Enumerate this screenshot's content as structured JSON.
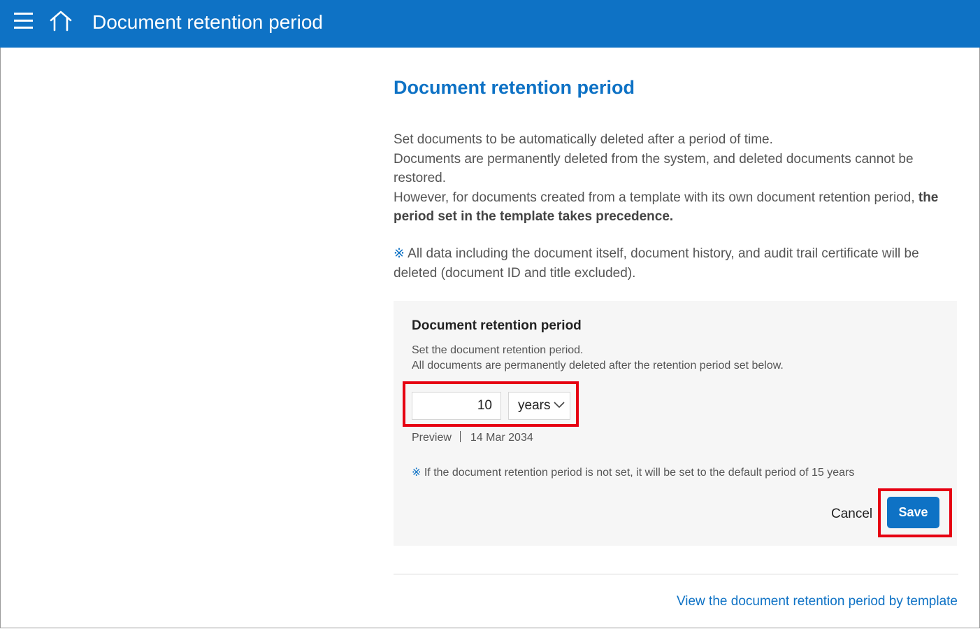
{
  "header": {
    "title": "Document retention period"
  },
  "main": {
    "title": "Document retention period",
    "description": {
      "line1": "Set documents to be automatically deleted after a period of time.",
      "line2": "Documents are permanently deleted from the system, and deleted documents cannot be restored.",
      "line3_plain": "However, for documents created from a template with its own document retention period, ",
      "line3_bold": "the period set in the template takes precedence."
    },
    "note": {
      "mark": "※",
      "text": "All data including the document itself, document history, and audit trail certificate will be deleted (document ID and title excluded)."
    }
  },
  "panel": {
    "title": "Document retention period",
    "desc1": "Set the document retention period.",
    "desc2": "All documents are permanently deleted after the retention period set below.",
    "period_value": "10",
    "period_unit": "years",
    "preview_label": "Preview",
    "preview_date": "14 Mar 2034",
    "note_mark": "※",
    "note_text": "If the document retention period is not set, it will be set to the default period of 15 years",
    "cancel_label": "Cancel",
    "save_label": "Save"
  },
  "footer": {
    "template_link": "View the document retention period by template"
  },
  "colors": {
    "brand": "#0e72c5",
    "highlight": "#e60012",
    "panel_bg": "#f6f6f6"
  },
  "icons": {
    "menu": "hamburger-menu-icon",
    "home": "home-icon",
    "dropdown": "chevron-down-icon"
  }
}
